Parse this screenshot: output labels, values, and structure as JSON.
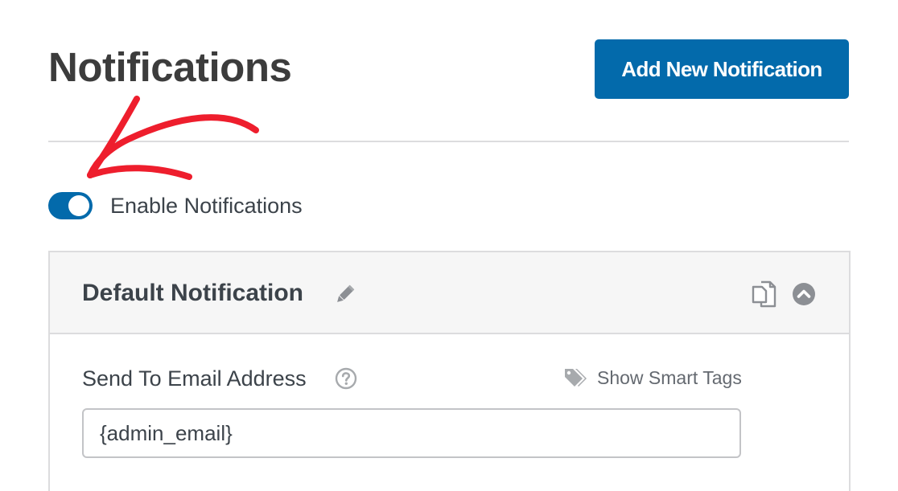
{
  "header": {
    "title": "Notifications",
    "add_button_label": "Add New Notification"
  },
  "toggle": {
    "label": "Enable Notifications",
    "state": "on"
  },
  "notification_panel": {
    "title": "Default Notification",
    "icons": [
      "pencil-icon",
      "copy-icon",
      "chevron-up-circle-icon"
    ],
    "field": {
      "label": "Send To Email Address",
      "help_icon": "question-circle-icon",
      "smart_tags_label": "Show Smart Tags",
      "smart_tags_icon": "tag-icon",
      "value": "{admin_email}"
    }
  },
  "colors": {
    "accent": "#036aab",
    "annotation_arrow": "#ee1e2d",
    "text": "#3c434a",
    "muted": "#646970",
    "border": "#dcdcde",
    "panel_header_bg": "#f6f6f6"
  }
}
